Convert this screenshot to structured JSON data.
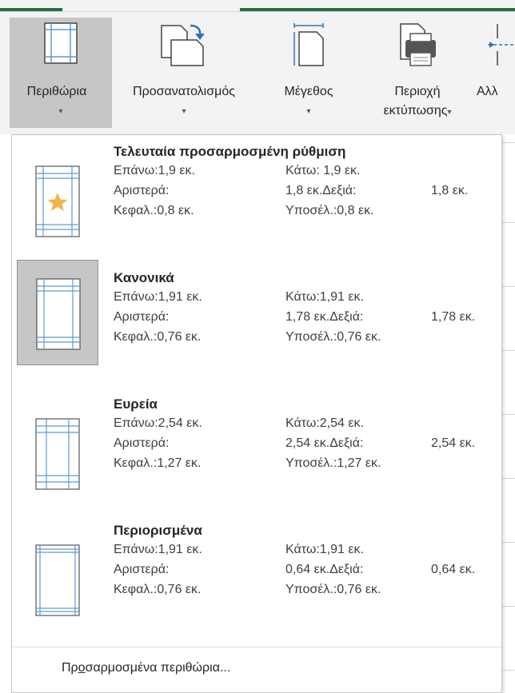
{
  "ribbon": {
    "buttons": [
      {
        "label": "Περιθώρια",
        "icon": "margins-icon"
      },
      {
        "label": "Προσανατολισμός",
        "icon": "orientation-icon"
      },
      {
        "label": "Μέγεθος",
        "icon": "size-icon"
      },
      {
        "label": "Περιοχή",
        "label2": "εκτύπωσης",
        "icon": "print-area-icon"
      },
      {
        "label": "Αλλ",
        "icon": "breaks-icon"
      }
    ],
    "dropdown_arrow": "▾"
  },
  "menu": {
    "items": [
      {
        "title": "Τελευταία προσαρμοσμένη ρύθμιση",
        "top": "Επάνω:1,9 εκ.",
        "bottom": "Κάτω: 1,9 εκ.",
        "left_label": "Αριστερά:",
        "left_value_right_label": "1,8 εκ.Δεξιά:",
        "right_value": "1,8 εκ.",
        "header": "Κεφαλ.:0,8 εκ.",
        "footer": "Υποσέλ.:0,8 εκ.",
        "icon": "star-icon"
      },
      {
        "title": "Κανονικά",
        "top": "Επάνω:1,91 εκ.",
        "bottom": "Κάτω:1,91 εκ.",
        "left_label": "Αριστερά:",
        "left_value_right_label": "1,78 εκ.Δεξιά:",
        "right_value": "1,78 εκ.",
        "header": "Κεφαλ.:0,76 εκ.",
        "footer": "Υποσέλ.:0,76 εκ."
      },
      {
        "title": "Ευρεία",
        "top": "Επάνω:2,54 εκ.",
        "bottom": "Κάτω:2,54 εκ.",
        "left_label": "Αριστερά:",
        "left_value_right_label": "2,54 εκ.Δεξιά:",
        "right_value": "2,54 εκ.",
        "header": "Κεφαλ.:1,27 εκ.",
        "footer": "Υποσέλ.:1,27 εκ."
      },
      {
        "title": "Περιορισμένα",
        "top": "Επάνω:1,91 εκ.",
        "bottom": "Κάτω:1,91 εκ.",
        "left_label": "Αριστερά:",
        "left_value_right_label": "0,64 εκ.Δεξιά:",
        "right_value": "0,64 εκ.",
        "header": "Κεφαλ.:0,76 εκ.",
        "footer": "Υποσέλ.:0,76 εκ."
      }
    ],
    "selected_index": 1,
    "footer_prefix": "Πρ",
    "footer_accel": "ο",
    "footer_rest": "σαρμοσμένα περιθώρια..."
  },
  "colors": {
    "accent": "#217346",
    "selected_bg": "#c6c6c6",
    "margin_line": "#5b9bd5",
    "star": "#f0b44b"
  }
}
